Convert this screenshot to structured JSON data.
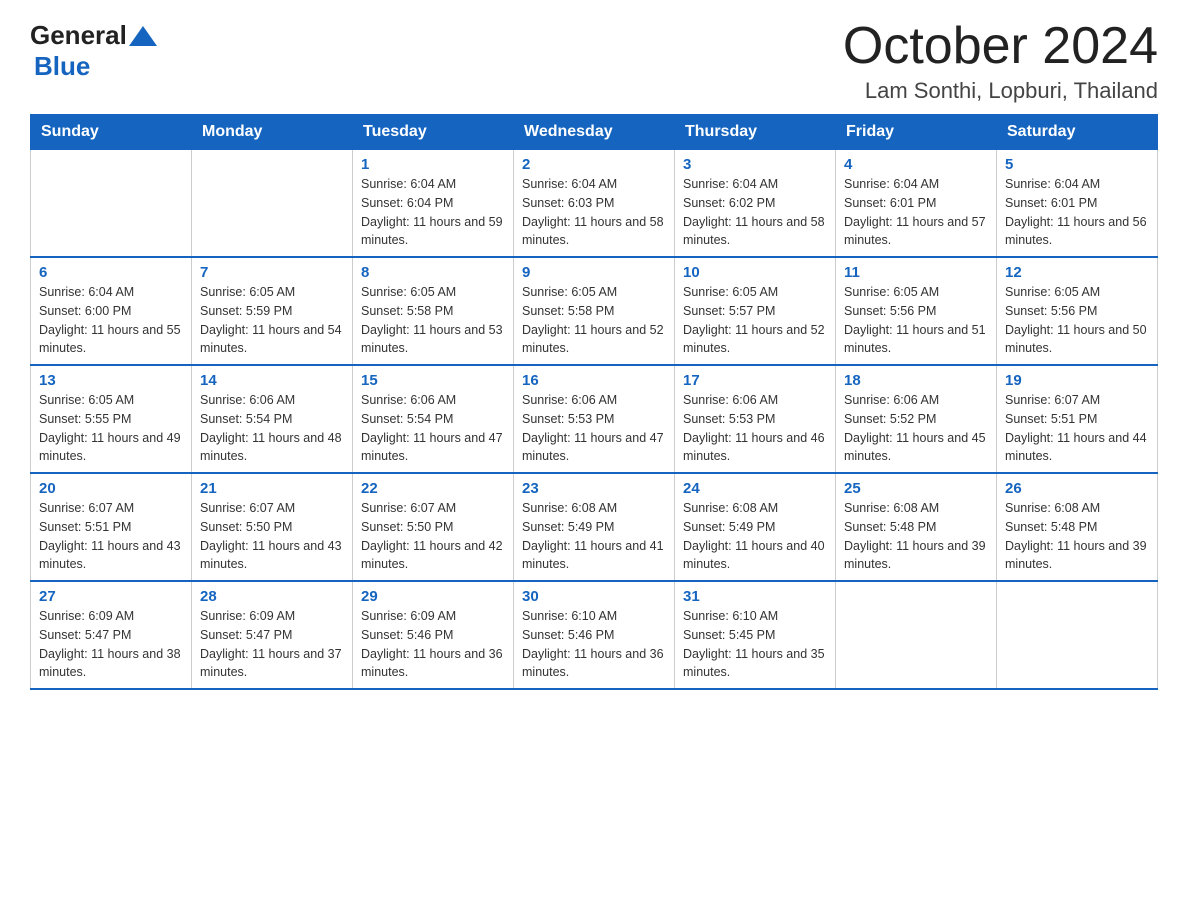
{
  "logo": {
    "general": "General",
    "blue": "Blue"
  },
  "header": {
    "month_title": "October 2024",
    "location": "Lam Sonthi, Lopburi, Thailand"
  },
  "weekdays": [
    "Sunday",
    "Monday",
    "Tuesday",
    "Wednesday",
    "Thursday",
    "Friday",
    "Saturday"
  ],
  "weeks": [
    [
      {
        "day": "",
        "sunrise": "",
        "sunset": "",
        "daylight": ""
      },
      {
        "day": "",
        "sunrise": "",
        "sunset": "",
        "daylight": ""
      },
      {
        "day": "1",
        "sunrise": "Sunrise: 6:04 AM",
        "sunset": "Sunset: 6:04 PM",
        "daylight": "Daylight: 11 hours and 59 minutes."
      },
      {
        "day": "2",
        "sunrise": "Sunrise: 6:04 AM",
        "sunset": "Sunset: 6:03 PM",
        "daylight": "Daylight: 11 hours and 58 minutes."
      },
      {
        "day": "3",
        "sunrise": "Sunrise: 6:04 AM",
        "sunset": "Sunset: 6:02 PM",
        "daylight": "Daylight: 11 hours and 58 minutes."
      },
      {
        "day": "4",
        "sunrise": "Sunrise: 6:04 AM",
        "sunset": "Sunset: 6:01 PM",
        "daylight": "Daylight: 11 hours and 57 minutes."
      },
      {
        "day": "5",
        "sunrise": "Sunrise: 6:04 AM",
        "sunset": "Sunset: 6:01 PM",
        "daylight": "Daylight: 11 hours and 56 minutes."
      }
    ],
    [
      {
        "day": "6",
        "sunrise": "Sunrise: 6:04 AM",
        "sunset": "Sunset: 6:00 PM",
        "daylight": "Daylight: 11 hours and 55 minutes."
      },
      {
        "day": "7",
        "sunrise": "Sunrise: 6:05 AM",
        "sunset": "Sunset: 5:59 PM",
        "daylight": "Daylight: 11 hours and 54 minutes."
      },
      {
        "day": "8",
        "sunrise": "Sunrise: 6:05 AM",
        "sunset": "Sunset: 5:58 PM",
        "daylight": "Daylight: 11 hours and 53 minutes."
      },
      {
        "day": "9",
        "sunrise": "Sunrise: 6:05 AM",
        "sunset": "Sunset: 5:58 PM",
        "daylight": "Daylight: 11 hours and 52 minutes."
      },
      {
        "day": "10",
        "sunrise": "Sunrise: 6:05 AM",
        "sunset": "Sunset: 5:57 PM",
        "daylight": "Daylight: 11 hours and 52 minutes."
      },
      {
        "day": "11",
        "sunrise": "Sunrise: 6:05 AM",
        "sunset": "Sunset: 5:56 PM",
        "daylight": "Daylight: 11 hours and 51 minutes."
      },
      {
        "day": "12",
        "sunrise": "Sunrise: 6:05 AM",
        "sunset": "Sunset: 5:56 PM",
        "daylight": "Daylight: 11 hours and 50 minutes."
      }
    ],
    [
      {
        "day": "13",
        "sunrise": "Sunrise: 6:05 AM",
        "sunset": "Sunset: 5:55 PM",
        "daylight": "Daylight: 11 hours and 49 minutes."
      },
      {
        "day": "14",
        "sunrise": "Sunrise: 6:06 AM",
        "sunset": "Sunset: 5:54 PM",
        "daylight": "Daylight: 11 hours and 48 minutes."
      },
      {
        "day": "15",
        "sunrise": "Sunrise: 6:06 AM",
        "sunset": "Sunset: 5:54 PM",
        "daylight": "Daylight: 11 hours and 47 minutes."
      },
      {
        "day": "16",
        "sunrise": "Sunrise: 6:06 AM",
        "sunset": "Sunset: 5:53 PM",
        "daylight": "Daylight: 11 hours and 47 minutes."
      },
      {
        "day": "17",
        "sunrise": "Sunrise: 6:06 AM",
        "sunset": "Sunset: 5:53 PM",
        "daylight": "Daylight: 11 hours and 46 minutes."
      },
      {
        "day": "18",
        "sunrise": "Sunrise: 6:06 AM",
        "sunset": "Sunset: 5:52 PM",
        "daylight": "Daylight: 11 hours and 45 minutes."
      },
      {
        "day": "19",
        "sunrise": "Sunrise: 6:07 AM",
        "sunset": "Sunset: 5:51 PM",
        "daylight": "Daylight: 11 hours and 44 minutes."
      }
    ],
    [
      {
        "day": "20",
        "sunrise": "Sunrise: 6:07 AM",
        "sunset": "Sunset: 5:51 PM",
        "daylight": "Daylight: 11 hours and 43 minutes."
      },
      {
        "day": "21",
        "sunrise": "Sunrise: 6:07 AM",
        "sunset": "Sunset: 5:50 PM",
        "daylight": "Daylight: 11 hours and 43 minutes."
      },
      {
        "day": "22",
        "sunrise": "Sunrise: 6:07 AM",
        "sunset": "Sunset: 5:50 PM",
        "daylight": "Daylight: 11 hours and 42 minutes."
      },
      {
        "day": "23",
        "sunrise": "Sunrise: 6:08 AM",
        "sunset": "Sunset: 5:49 PM",
        "daylight": "Daylight: 11 hours and 41 minutes."
      },
      {
        "day": "24",
        "sunrise": "Sunrise: 6:08 AM",
        "sunset": "Sunset: 5:49 PM",
        "daylight": "Daylight: 11 hours and 40 minutes."
      },
      {
        "day": "25",
        "sunrise": "Sunrise: 6:08 AM",
        "sunset": "Sunset: 5:48 PM",
        "daylight": "Daylight: 11 hours and 39 minutes."
      },
      {
        "day": "26",
        "sunrise": "Sunrise: 6:08 AM",
        "sunset": "Sunset: 5:48 PM",
        "daylight": "Daylight: 11 hours and 39 minutes."
      }
    ],
    [
      {
        "day": "27",
        "sunrise": "Sunrise: 6:09 AM",
        "sunset": "Sunset: 5:47 PM",
        "daylight": "Daylight: 11 hours and 38 minutes."
      },
      {
        "day": "28",
        "sunrise": "Sunrise: 6:09 AM",
        "sunset": "Sunset: 5:47 PM",
        "daylight": "Daylight: 11 hours and 37 minutes."
      },
      {
        "day": "29",
        "sunrise": "Sunrise: 6:09 AM",
        "sunset": "Sunset: 5:46 PM",
        "daylight": "Daylight: 11 hours and 36 minutes."
      },
      {
        "day": "30",
        "sunrise": "Sunrise: 6:10 AM",
        "sunset": "Sunset: 5:46 PM",
        "daylight": "Daylight: 11 hours and 36 minutes."
      },
      {
        "day": "31",
        "sunrise": "Sunrise: 6:10 AM",
        "sunset": "Sunset: 5:45 PM",
        "daylight": "Daylight: 11 hours and 35 minutes."
      },
      {
        "day": "",
        "sunrise": "",
        "sunset": "",
        "daylight": ""
      },
      {
        "day": "",
        "sunrise": "",
        "sunset": "",
        "daylight": ""
      }
    ]
  ]
}
